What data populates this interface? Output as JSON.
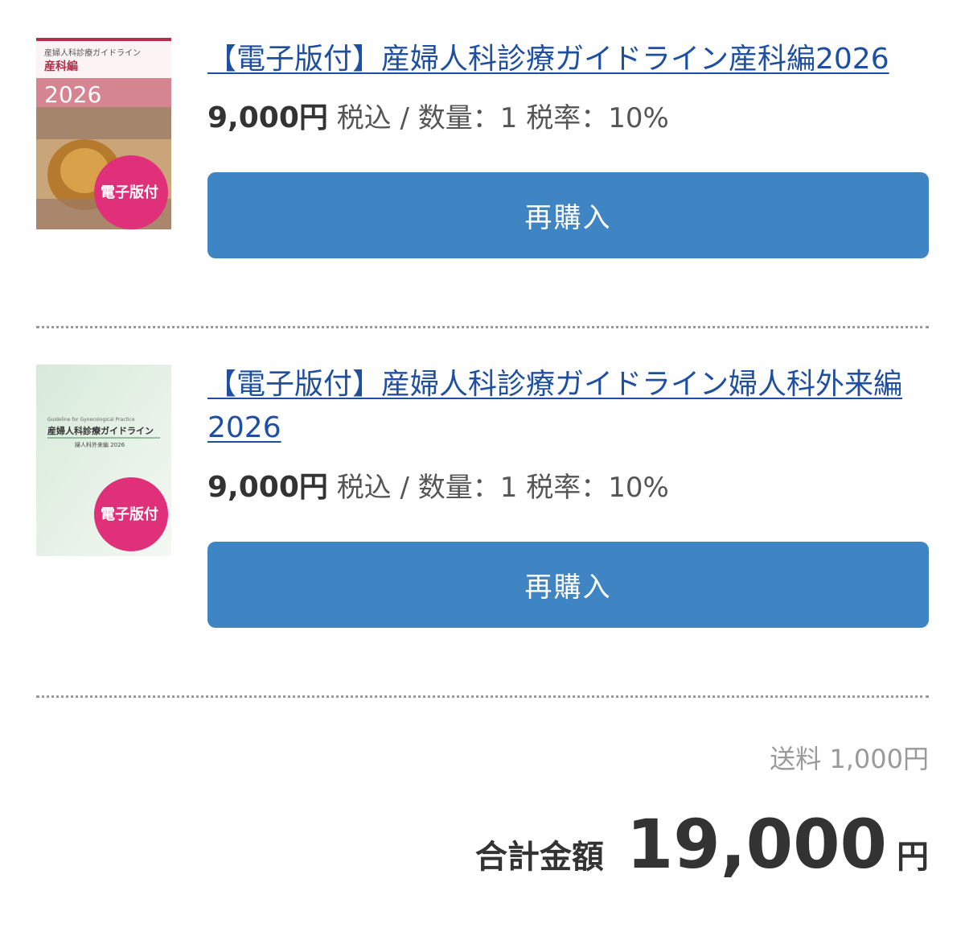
{
  "items": [
    {
      "title": "【電子版付】産婦人科診療ガイドライン産科編2026",
      "price": "9,000円",
      "meta": "税込 / 数量：1 税率：10%",
      "rebuy_label": "再購入",
      "cover": {
        "series_title": "産婦人科診療ガイドライン",
        "volume": "産科編",
        "year": "2026",
        "badge": "電子版付",
        "accent_color": "#b0304a",
        "badge_color": "#e0307a"
      }
    },
    {
      "title": "【電子版付】産婦人科診療ガイドライン婦人科外来編2026",
      "price": "9,000円",
      "meta": "税込 / 数量：1 税率：10%",
      "rebuy_label": "再購入",
      "cover": {
        "english": "Guideline for Gynecological Practice",
        "series_title": "産婦人科診療ガイドライン",
        "volume": "婦人科外来編 2026",
        "badge": "電子版付",
        "badge_color": "#e0307a"
      }
    }
  ],
  "summary": {
    "shipping": "送料 1,000円",
    "total_label": "合計金額",
    "total_value": "19,000",
    "total_unit": "円"
  },
  "colors": {
    "link": "#1e4fa0",
    "button": "#3f85c4"
  }
}
